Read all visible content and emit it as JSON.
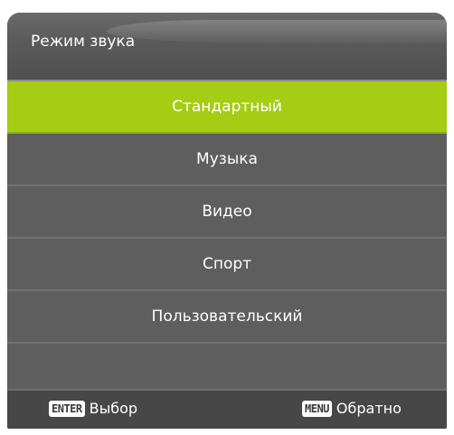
{
  "header": {
    "title": "Режим звука"
  },
  "menu": {
    "items": [
      {
        "label": "Стандартный",
        "selected": true
      },
      {
        "label": "Музыка",
        "selected": false
      },
      {
        "label": "Видео",
        "selected": false
      },
      {
        "label": "Спорт",
        "selected": false
      },
      {
        "label": "Пользовательский",
        "selected": false
      },
      {
        "label": "",
        "selected": false
      }
    ]
  },
  "footer": {
    "enter_key": "ENTER",
    "enter_label": "Выбор",
    "menu_key": "MENU",
    "menu_label": "Обратно"
  },
  "colors": {
    "accent": "#a6cc14",
    "panel": "#5e5e5e",
    "footer": "#474747"
  }
}
